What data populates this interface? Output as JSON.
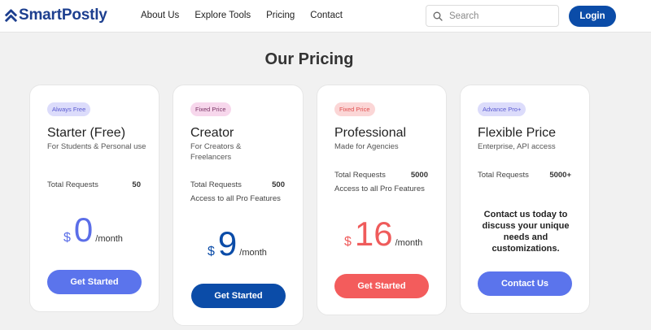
{
  "brand": {
    "name": "SmartPostly",
    "icon": "chevron-up-icon",
    "color": "#1d3f8f"
  },
  "nav": {
    "items": [
      "About Us",
      "Explore Tools",
      "Pricing",
      "Contact"
    ]
  },
  "search": {
    "placeholder": "Search",
    "icon": "search-icon"
  },
  "login": {
    "label": "Login",
    "color": "#0b4ca8"
  },
  "page_title": "Our Pricing",
  "plans": [
    {
      "badge": "Always Free",
      "badge_bg": "#dcdcfb",
      "badge_color": "#5a5ad0",
      "title": "Starter (Free)",
      "subtitle": "For Students & Personal use",
      "requests_label": "Total Requests",
      "requests_value": "50",
      "currency": "$",
      "amount": "0",
      "period": "/month",
      "price_color": "#5b6ee8",
      "button": "Get Started",
      "button_color": "#5b74ec"
    },
    {
      "badge": "Fixed Price",
      "badge_bg": "#f7d7ec",
      "badge_color": "#7a3465",
      "title": "Creator",
      "subtitle": "For Creators & Freelancers",
      "requests_label": "Total Requests",
      "requests_value": "500",
      "feature": "Access to all Pro Features",
      "currency": "$",
      "amount": "9",
      "period": "/month",
      "price_color": "#0b4ca8",
      "button": "Get Started",
      "button_color": "#0b4ca8"
    },
    {
      "badge": "Fixed Price",
      "badge_bg": "#fbd6d6",
      "badge_color": "#e05050",
      "title": "Professional",
      "subtitle": "Made for Agencies",
      "requests_label": "Total Requests",
      "requests_value": "5000",
      "feature": "Access to all Pro Features",
      "currency": "$",
      "amount": "16",
      "period": "/month",
      "price_color": "#ef5b5b",
      "button": "Get Started",
      "button_color": "#f35c5c"
    },
    {
      "badge": "Advance Pro+",
      "badge_bg": "#dcdcfb",
      "badge_color": "#5a5ad0",
      "title": "Flexible Price",
      "subtitle": "Enterprise, API access",
      "requests_label": "Total Requests",
      "requests_value": "5000+",
      "contact_text": "Contact us today to discuss your unique needs and customizations.",
      "button": "Contact Us",
      "button_color": "#5b74ec"
    }
  ]
}
